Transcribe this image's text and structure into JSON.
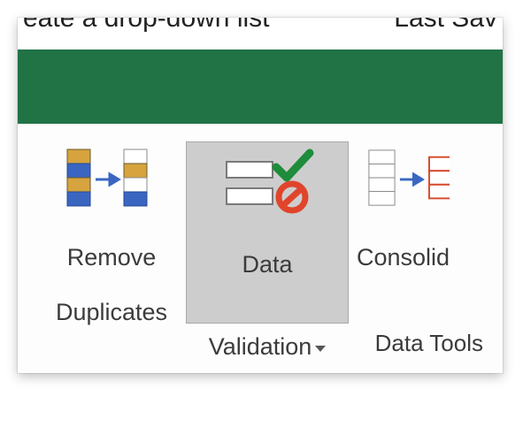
{
  "titlebar": {
    "left_fragment": "eate a drop-down list",
    "right_fragment": "Last Sav"
  },
  "ribbon": {
    "group_label": "Data Tools",
    "buttons": {
      "remove_duplicates": {
        "line1": "Remove",
        "line2": "Duplicates"
      },
      "data_validation": {
        "line1": "Data",
        "line2": "Validation"
      },
      "consolidate": {
        "line1": "Consolid"
      }
    }
  }
}
